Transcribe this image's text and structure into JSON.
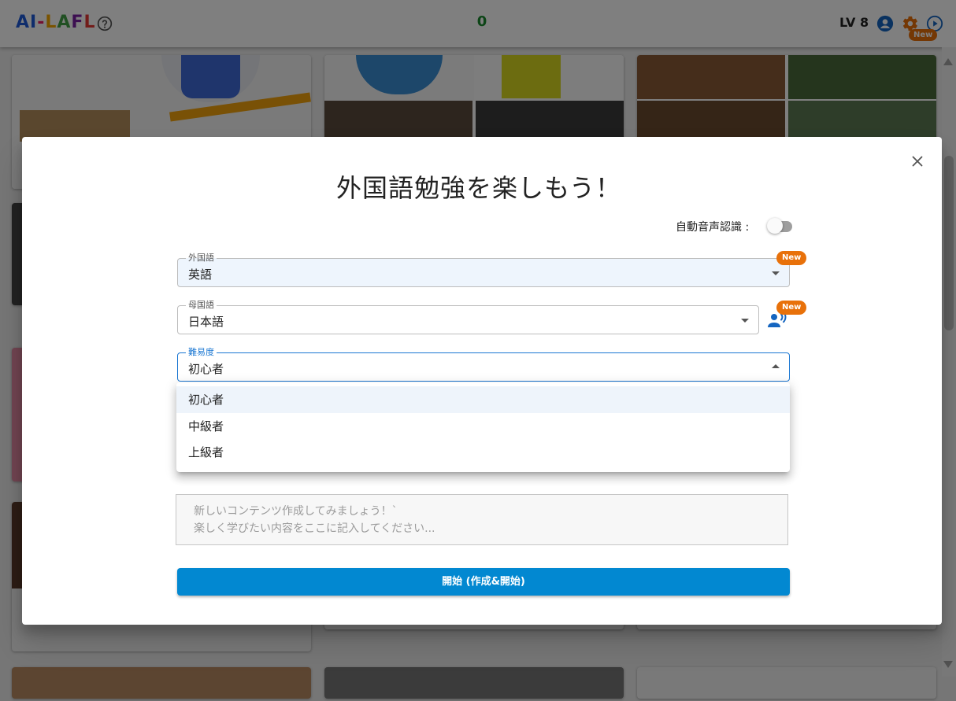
{
  "app": {
    "logo": [
      {
        "char": "A",
        "color": "#1e5bd8"
      },
      {
        "char": "I",
        "color": "#1e5bd8"
      },
      {
        "char": "-",
        "color": "#e91e63"
      },
      {
        "char": "L",
        "color": "#f4a700"
      },
      {
        "char": "A",
        "color": "#43a047"
      },
      {
        "char": "F",
        "color": "#7b1fa2"
      },
      {
        "char": "L",
        "color": "#e53935"
      }
    ],
    "score": "0",
    "level": "LV 8",
    "settings_badge": "New",
    "icons": [
      "help-icon",
      "account-icon",
      "gear-icon",
      "play-icon"
    ]
  },
  "dialog": {
    "title": "外国語勉強を楽しもう！",
    "auto_speech_label": "自動音声認識 :",
    "auto_speech_on": false,
    "foreign_language": {
      "label": "外国語",
      "value": "英語",
      "badge": "New"
    },
    "native_language": {
      "label": "母国語",
      "value": "日本語",
      "badge": "New"
    },
    "difficulty": {
      "label": "難易度",
      "value": "初心者",
      "options": [
        "初心者",
        "中級者",
        "上級者"
      ]
    },
    "content_placeholder": "新しいコンテンツ作成してみましょう！`\n楽しく学びたい内容をここに記入してください...",
    "start_button": "開始 (作成&開始)"
  },
  "colors": {
    "primary": "#0288d1",
    "accent_badge": "#e8710a",
    "focus": "#1976d2",
    "score": "#1a8a2e"
  }
}
